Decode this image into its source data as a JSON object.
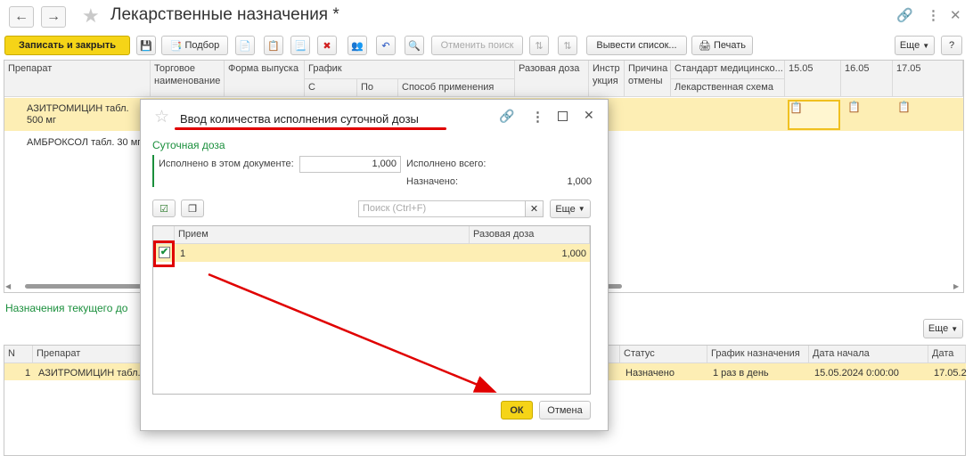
{
  "window": {
    "title": "Лекарственные назначения *"
  },
  "toolbar": {
    "save_close": "Записать и закрыть",
    "selection": "Подбор",
    "cancel_search": "Отменить поиск",
    "output_list": "Вывести список...",
    "print": "Печать",
    "more": "Еще"
  },
  "grid": {
    "headers": {
      "drug": "Препарат",
      "trade_name": "Торговое наименование",
      "form": "Форма выпуска",
      "schedule": "График",
      "from": "С",
      "to": "По",
      "method": "Способ применения",
      "single_dose": "Разовая доза",
      "instruction": "Инстр укция",
      "reason": "Причина отмены",
      "standard": "Стандарт медицинско...",
      "scheme": "Лекарственная схема",
      "d1": "15.05",
      "d2": "16.05",
      "d3": "17.05"
    },
    "rows": [
      {
        "drug": "АЗИТРОМИЦИН табл. 500 мг"
      },
      {
        "drug": "АМБРОКСОЛ табл. 30 мг"
      }
    ]
  },
  "bottom": {
    "section_title": "Назначения текущего до",
    "more": "Еще",
    "headers": {
      "n": "N",
      "drug": "Препарат",
      "status": "Статус",
      "schedule": "График назначения",
      "start_date": "Дата начала назначения",
      "end_date": "Дата о"
    },
    "row": {
      "n": "1",
      "drug": "АЗИТРОМИЦИН табл.",
      "status": "Назначено",
      "schedule": "1 раз в день",
      "start_date": "15.05.2024 0:00:00",
      "end_date": "17.05.2"
    }
  },
  "dialog": {
    "title": "Ввод количества исполнения суточной дозы",
    "group_title": "Суточная доза",
    "executed_label": "Исполнено в этом документе:",
    "executed_value": "1,000",
    "executed_total_label": "Исполнено всего:",
    "assigned_label": "Назначено:",
    "assigned_value": "1,000",
    "search_placeholder": "Поиск (Ctrl+F)",
    "more": "Еще",
    "table": {
      "col_reception": "Прием",
      "col_dose": "Разовая доза",
      "rows": [
        {
          "reception": "1",
          "dose": "1,000",
          "checked": true
        }
      ]
    },
    "ok": "ОК",
    "cancel": "Отмена"
  },
  "colors": {
    "accent_yellow": "#f5d417",
    "selection": "#fdeeb4",
    "green": "#1a8f3c",
    "annotation_red": "#e00000"
  }
}
